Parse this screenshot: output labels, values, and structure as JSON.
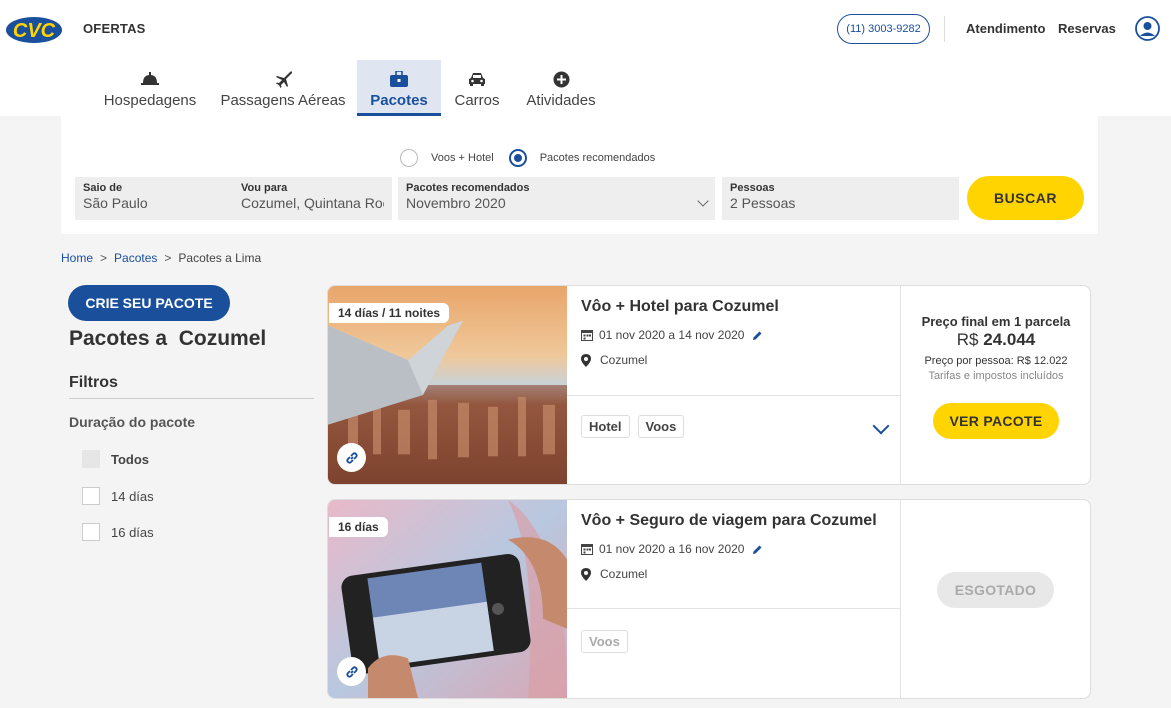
{
  "header": {
    "logo": "CVC",
    "ofertas_label": "OFERTAS",
    "phone": "(11) 3003-9282",
    "atendimento": "Atendimento",
    "reservas": "Reservas",
    "avatar_icon": "user-circle-icon"
  },
  "tabs": [
    {
      "label": "Hospedagens",
      "icon": "bell-icon"
    },
    {
      "label": "Passagens Aéreas",
      "icon": "airplane-icon"
    },
    {
      "label": "Pacotes",
      "icon": "suitcase-icon",
      "active": true
    },
    {
      "label": "Carros",
      "icon": "car-icon"
    },
    {
      "label": "Atividades",
      "icon": "plus-circle-icon"
    }
  ],
  "search": {
    "radio_options": [
      "Voos + Hotel",
      "Pacotes recomendados"
    ],
    "radio_selected": "Pacotes recomendados",
    "origin": {
      "label": "Saio de",
      "value": "São Paulo"
    },
    "destination": {
      "label": "Vou para",
      "value": "Cozumel, Quintana Roo"
    },
    "month": {
      "label": "Pacotes recomendados",
      "value": "Novembro 2020"
    },
    "people": {
      "label": "Pessoas",
      "value": "2 Pessoas"
    },
    "button": "BUSCAR"
  },
  "breadcrumb": {
    "home": "Home",
    "sep": ">",
    "pacotes": "Pacotes",
    "current": "Pacotes a Lima"
  },
  "sidebar": {
    "create_button": "CRIE SEU PACOTE",
    "title": "Pacotes a  Cozumel",
    "filters_title": "Filtros",
    "duration_title": "Duração do pacote",
    "options": [
      "Todos",
      "14 días",
      "16 días"
    ]
  },
  "cards": [
    {
      "badge": "14 días /  11 noites",
      "title": "Vôo + Hotel para Cozumel",
      "dates": "01 nov 2020 a 14 nov 2020",
      "location": "Cozumel",
      "tags": [
        "Hotel",
        "Voos"
      ],
      "price_label": "Preço final em 1 parcela",
      "price_currency": "R$",
      "price_value": "24.044",
      "price_per_person": "Preço por pessoa: R$ 12.022",
      "taxes": "Tarifas e impostos incluídos",
      "button": "VER PACOTE"
    },
    {
      "badge": "16 días",
      "title": "Vôo + Seguro de viagem para Cozumel",
      "dates": "01 nov 2020 a 16 nov 2020",
      "location": "Cozumel",
      "tags": [
        "Voos"
      ],
      "button": "ESGOTADO"
    }
  ],
  "colors": {
    "brand_blue": "#1a4f9c",
    "accent_yellow": "#ffd400"
  }
}
